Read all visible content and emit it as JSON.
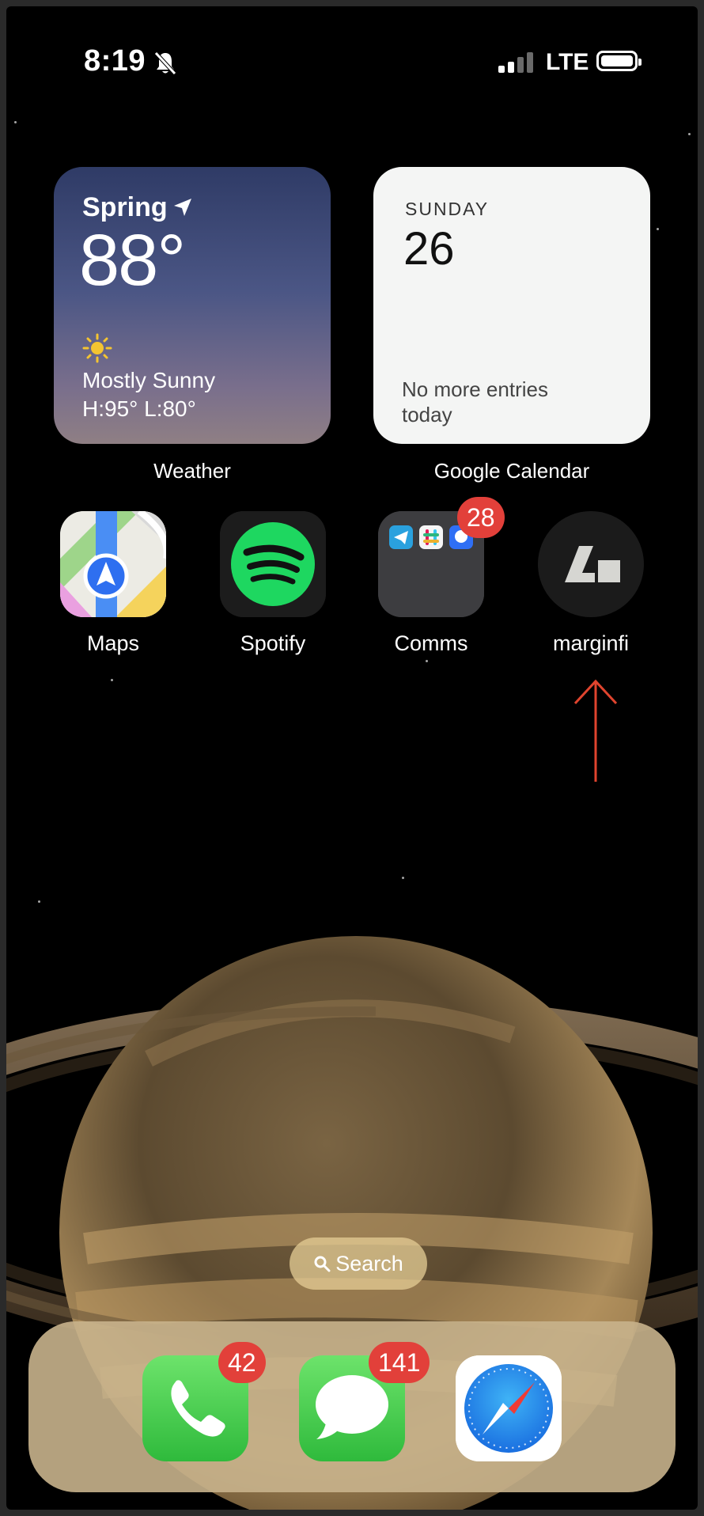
{
  "status_bar": {
    "time": "8:19",
    "network": "LTE",
    "silent_icon": "bell-slash-icon",
    "signal_icon": "cellular-signal-icon",
    "battery_icon": "battery-icon"
  },
  "widgets": {
    "weather": {
      "city": "Spring",
      "temperature": "88°",
      "condition": "Mostly Sunny",
      "high_low": "H:95° L:80°",
      "label": "Weather"
    },
    "calendar": {
      "weekday": "SUNDAY",
      "date": "26",
      "message": "No more entries today",
      "label": "Google Calendar"
    }
  },
  "apps": [
    {
      "label": "Maps",
      "icon": "maps-icon"
    },
    {
      "label": "Spotify",
      "icon": "spotify-icon"
    },
    {
      "label": "Comms",
      "icon": "folder-icon",
      "badge": "28"
    },
    {
      "label": "marginfi",
      "icon": "marginfi-icon"
    }
  ],
  "search": {
    "label": "Search"
  },
  "dock": [
    {
      "icon": "phone-icon",
      "badge": "42"
    },
    {
      "icon": "messages-icon",
      "badge": "141"
    },
    {
      "icon": "safari-icon"
    }
  ],
  "colors": {
    "badge": "#e2403a",
    "annotation_arrow": "#e0442e"
  }
}
